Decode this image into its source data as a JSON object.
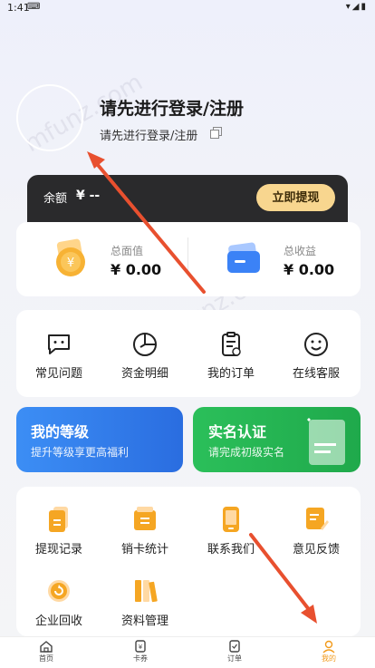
{
  "status_bar": {
    "time": "1:41"
  },
  "profile": {
    "title": "请先进行登录/注册",
    "subtitle": "请先进行登录/注册"
  },
  "balance": {
    "label": "余额",
    "value": "¥ --",
    "withdraw_label": "立即提现"
  },
  "totals": {
    "total_face": {
      "label": "总面值",
      "value": "¥ 0.00"
    },
    "total_income": {
      "label": "总收益",
      "value": "¥ 0.00"
    }
  },
  "menu1": [
    {
      "label": "常见问题",
      "icon": "faq-icon"
    },
    {
      "label": "资金明细",
      "icon": "fund-detail-icon"
    },
    {
      "label": "我的订单",
      "icon": "order-icon"
    },
    {
      "label": "在线客服",
      "icon": "customer-service-icon"
    }
  ],
  "level_card": {
    "title": "我的等级",
    "subtitle": "提升等级享更高福利"
  },
  "verify_card": {
    "title": "实名认证",
    "subtitle": "请完成初级实名"
  },
  "menu2": [
    {
      "label": "提现记录",
      "icon": "withdraw-record-icon"
    },
    {
      "label": "销卡统计",
      "icon": "card-stats-icon"
    },
    {
      "label": "联系我们",
      "icon": "contact-icon"
    },
    {
      "label": "意见反馈",
      "icon": "feedback-icon"
    },
    {
      "label": "企业回收",
      "icon": "enterprise-recycle-icon"
    },
    {
      "label": "资料管理",
      "icon": "data-manage-icon"
    }
  ],
  "tabs": [
    {
      "label": "首页",
      "icon": "home-icon"
    },
    {
      "label": "卡券",
      "icon": "coupon-icon"
    },
    {
      "label": "订单",
      "icon": "order-tab-icon"
    },
    {
      "label": "我的",
      "icon": "me-icon",
      "active": true
    }
  ],
  "colors": {
    "accent": "#f29a1a",
    "withdraw_button": "#f8d68f",
    "level_card": "#3c8ef5",
    "verify_card": "#2bbf5a",
    "annotation_arrow": "#e8502f"
  }
}
